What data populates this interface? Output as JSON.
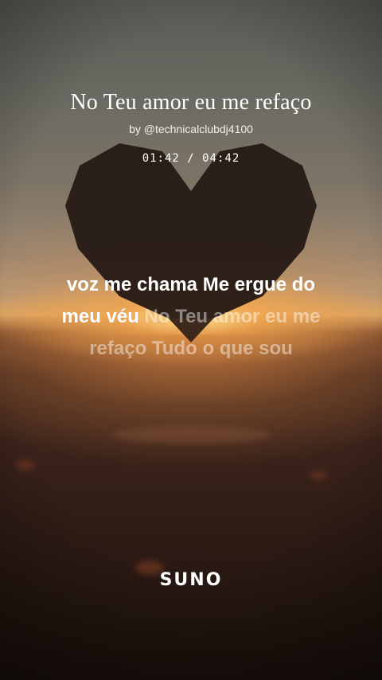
{
  "song": {
    "title": "No Teu amor eu me refaço",
    "artist": "by @technicalclubdj4100",
    "time": "01:42 / 04:42"
  },
  "lyrics": {
    "active": [
      "voz me chama Me ergue do",
      "meu véu"
    ],
    "upcoming": [
      "No Teu amor eu me",
      "refaço Tudo o que sou"
    ]
  },
  "brand": {
    "logo": "SUNO"
  },
  "icons": {
    "background": "heart-silhouette"
  },
  "colors": {
    "lyric_active": "#ffffff",
    "lyric_upcoming": "rgba(255,255,255,0.45)"
  }
}
